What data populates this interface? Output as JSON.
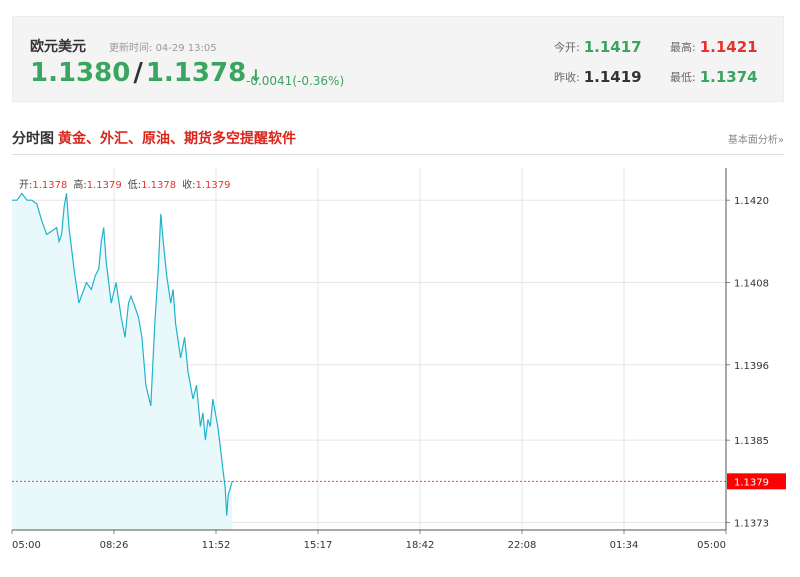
{
  "quote": {
    "pair_name": "欧元美元",
    "update_label": "更新时间:",
    "update_time": "04-29 13:05",
    "bid": "1.1380",
    "ask": "1.1378",
    "arrow": "↓",
    "change": "-0.0041(-0.36%)",
    "open_label": "今开:",
    "open": "1.1417",
    "high_label": "最高:",
    "high": "1.1421",
    "prev_close_label": "昨收:",
    "prev_close": "1.1419",
    "low_label": "最低:",
    "low": "1.1374"
  },
  "section": {
    "title": "分时图",
    "promo": "黄金、外汇、原油、期货多空提醒软件",
    "analysis_link": "基本面分析»"
  },
  "ohlc": {
    "open_label": "开:",
    "open": "1.1378",
    "high_label": "高:",
    "high": "1.1379",
    "low_label": "低:",
    "low": "1.1378",
    "close_label": "收:",
    "close": "1.1379"
  },
  "colors": {
    "line": "#1fb3cc",
    "fill": "#e9f8fb",
    "reference": "#e5322d",
    "price_tag": "#ff0000",
    "grid": "#e6e6e6",
    "up": "#e5322d",
    "down": "#3aa55e"
  },
  "chart_data": {
    "type": "area",
    "x_ticks": [
      "05:00",
      "08:26",
      "11:52",
      "15:17",
      "18:42",
      "22:08",
      "01:34",
      "05:00"
    ],
    "y_ticks": [
      1.142,
      1.1408,
      1.1396,
      1.1385,
      1.1373
    ],
    "y_tick_labels": [
      "1.1420",
      "1.1408",
      "1.1396",
      "1.1385",
      "1.1373"
    ],
    "ylim": [
      1.13719,
      1.14247
    ],
    "x_range_minutes": [
      0,
      1440
    ],
    "grid": true,
    "current_price": 1.1379,
    "current_price_label": "1.1379",
    "series": [
      {
        "values": [
          [
            0,
            1.142
          ],
          [
            10,
            1.142
          ],
          [
            20,
            1.1421
          ],
          [
            30,
            1.142
          ],
          [
            40,
            1.142
          ],
          [
            50,
            1.14195
          ],
          [
            60,
            1.1417
          ],
          [
            70,
            1.1415
          ],
          [
            80,
            1.14155
          ],
          [
            90,
            1.1416
          ],
          [
            95,
            1.1414
          ],
          [
            100,
            1.1415
          ],
          [
            105,
            1.1419
          ],
          [
            110,
            1.1421
          ],
          [
            115,
            1.1416
          ],
          [
            125,
            1.141
          ],
          [
            135,
            1.1405
          ],
          [
            140,
            1.1406
          ],
          [
            150,
            1.1408
          ],
          [
            160,
            1.1407
          ],
          [
            168,
            1.1409
          ],
          [
            175,
            1.141
          ],
          [
            180,
            1.1414
          ],
          [
            185,
            1.1416
          ],
          [
            190,
            1.1411
          ],
          [
            200,
            1.1405
          ],
          [
            210,
            1.1408
          ],
          [
            220,
            1.1403
          ],
          [
            228,
            1.14
          ],
          [
            235,
            1.1405
          ],
          [
            240,
            1.1406
          ],
          [
            245,
            1.1405
          ],
          [
            255,
            1.1403
          ],
          [
            262,
            1.14
          ],
          [
            270,
            1.1393
          ],
          [
            280,
            1.139
          ],
          [
            288,
            1.1402
          ],
          [
            295,
            1.141
          ],
          [
            300,
            1.1418
          ],
          [
            305,
            1.1414
          ],
          [
            312,
            1.1409
          ],
          [
            320,
            1.1405
          ],
          [
            325,
            1.1407
          ],
          [
            330,
            1.1402
          ],
          [
            340,
            1.1397
          ],
          [
            348,
            1.14
          ],
          [
            355,
            1.1395
          ],
          [
            365,
            1.1391
          ],
          [
            372,
            1.1393
          ],
          [
            380,
            1.1387
          ],
          [
            385,
            1.1389
          ],
          [
            390,
            1.1385
          ],
          [
            395,
            1.1388
          ],
          [
            400,
            1.1387
          ],
          [
            405,
            1.1391
          ],
          [
            410,
            1.1389
          ],
          [
            415,
            1.1387
          ],
          [
            420,
            1.1384
          ],
          [
            425,
            1.1381
          ],
          [
            430,
            1.1378
          ],
          [
            433,
            1.1374
          ],
          [
            436,
            1.1377
          ],
          [
            440,
            1.1378
          ],
          [
            444,
            1.1379
          ]
        ]
      }
    ]
  }
}
